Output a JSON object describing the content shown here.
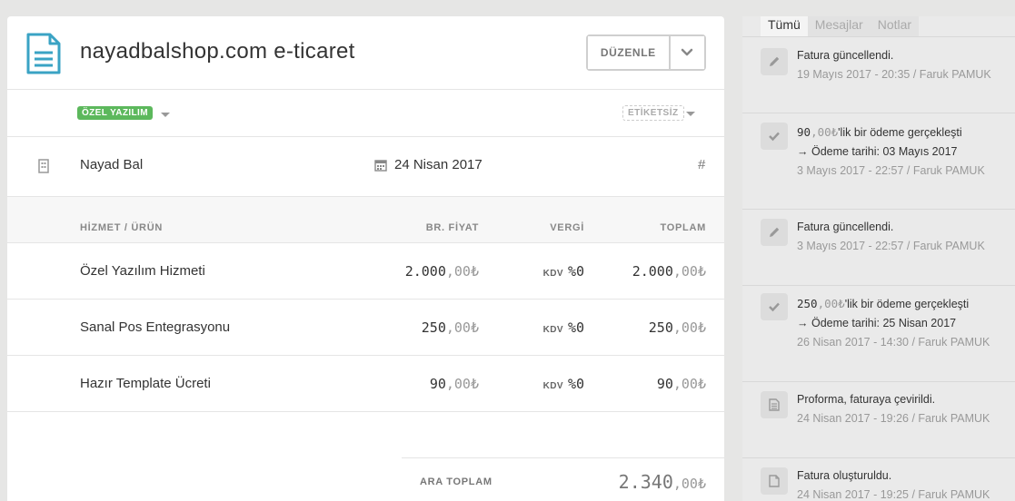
{
  "invoice": {
    "title": "nayadbalshop.com e-ticaret",
    "edit_label": "DÜZENLE",
    "category_label": "ÖZEL YAZILIM",
    "tag_label": "ETİKETSİZ",
    "customer": "Nayad Bal",
    "date": "24 Nisan 2017",
    "number_symbol": "#",
    "columns": {
      "product": "HİZMET / ÜRÜN",
      "unit_price": "BR. FİYAT",
      "tax": "VERGİ",
      "total": "TOPLAM"
    },
    "items": [
      {
        "name": "Özel Yazılım Hizmeti",
        "price_int": "2.000",
        "price_dec": ",00₺",
        "tax_label": "KDV",
        "tax_value": "%0",
        "total_int": "2.000",
        "total_dec": ",00₺"
      },
      {
        "name": "Sanal Pos Entegrasyonu",
        "price_int": "250",
        "price_dec": ",00₺",
        "tax_label": "KDV",
        "tax_value": "%0",
        "total_int": "250",
        "total_dec": ",00₺"
      },
      {
        "name": "Hazır Template Ücreti",
        "price_int": "90",
        "price_dec": ",00₺",
        "tax_label": "KDV",
        "tax_value": "%0",
        "total_int": "90",
        "total_dec": ",00₺"
      }
    ],
    "subtotal_label": "ARA TOPLAM",
    "subtotal_int": "2.340",
    "subtotal_dec": ",00₺"
  },
  "activity_panel": {
    "tabs": [
      {
        "label": "Tümü",
        "active": true
      },
      {
        "label": "Mesajlar",
        "active": false
      },
      {
        "label": "Notlar",
        "active": false
      }
    ],
    "events": [
      {
        "icon": "pencil-icon",
        "title": "Fatura güncellendi.",
        "meta": "19 Mayıs 2017 - 20:35 / Faruk PAMUK"
      },
      {
        "icon": "check-icon",
        "amount_int": "90",
        "amount_dec": ",00₺",
        "title": "'lik bir ödeme gerçekleşti",
        "subtitle": "→ Ödeme tarihi: 03 Mayıs 2017",
        "meta": "3 Mayıs 2017 - 22:57 / Faruk PAMUK"
      },
      {
        "icon": "pencil-icon",
        "title": "Fatura güncellendi.",
        "meta": "3 Mayıs 2017 - 22:57 / Faruk PAMUK"
      },
      {
        "icon": "check-icon",
        "amount_int": "250",
        "amount_dec": ",00₺",
        "title": "'lik bir ödeme gerçekleşti",
        "subtitle": "→ Ödeme tarihi: 25 Nisan 2017",
        "meta": "26 Nisan 2017 - 14:30 / Faruk PAMUK"
      },
      {
        "icon": "document-icon",
        "title": "Proforma, faturaya çevirildi.",
        "meta": "24 Nisan 2017 - 19:26 / Faruk PAMUK"
      },
      {
        "icon": "file-icon",
        "title": "Fatura oluşturuldu.",
        "meta": "24 Nisan 2017 - 19:25 / Faruk PAMUK"
      }
    ]
  },
  "colors": {
    "background": "#e6e6e5",
    "card": "#ffffff",
    "accent_icon": "#3aa3c4",
    "category_green": "#5cb85c",
    "panel": "#eaeaea"
  }
}
